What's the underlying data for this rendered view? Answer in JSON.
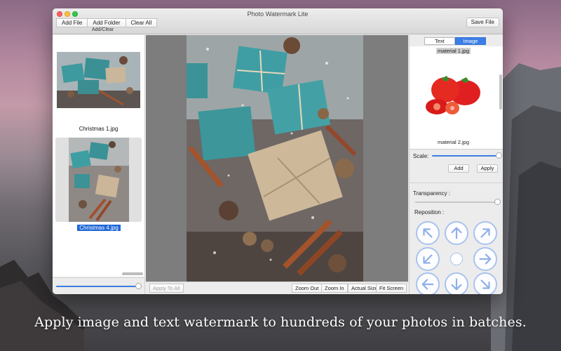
{
  "window": {
    "title": "Photo Watermark Lite"
  },
  "toolbar": {
    "add_file": "Add File",
    "add_folder": "Add Folder",
    "clear_all": "Clear All",
    "group_label": "Add/Clear",
    "save_file": "Save File"
  },
  "file_list": {
    "items": [
      {
        "name": "Christmas 1.jpg",
        "selected": false
      },
      {
        "name": "Christmas 4.jpg",
        "selected": true
      }
    ],
    "thumb_zoom": 1.0
  },
  "preview_bar": {
    "apply_to_all": "Apply To All",
    "zoom_out": "Zoom Out",
    "zoom_in": "Zoom In",
    "actual_size": "Actual Size",
    "fit_screen": "Fit Screen"
  },
  "watermark_panel": {
    "tabs": [
      "Text",
      "Image"
    ],
    "active_tab": "Image",
    "materials": [
      "material 1.jpg",
      "material 2.jpg"
    ],
    "scale_label": "Scale:",
    "scale_value": 1.0,
    "add_label": "Add",
    "apply_label": "Apply",
    "transparency_label": "Transparency :",
    "transparency_value": 1.0,
    "reposition_label": "Reposition :",
    "reposition_icons": [
      "arrow-up-left-icon",
      "arrow-up-icon",
      "arrow-up-right-icon",
      "arrow-left-icon",
      "center-icon",
      "arrow-right-icon",
      "arrow-down-left-icon",
      "arrow-down-icon",
      "arrow-down-right-icon"
    ]
  },
  "colors": {
    "accent": "#3c7ee6",
    "selection": "#1e66d6",
    "arrow_ring": "#a9c3ee"
  },
  "caption": "Apply image and text watermark to hundreds of your photos in batches."
}
